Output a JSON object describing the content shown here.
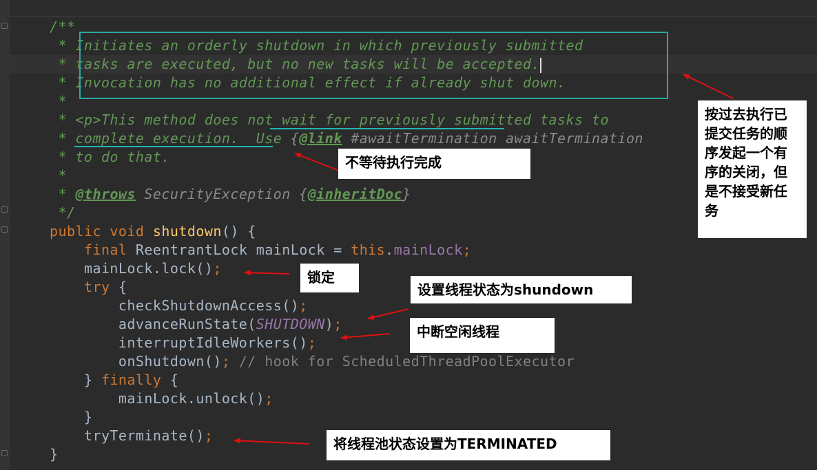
{
  "code_lines": [
    {
      "parts": [
        {
          "t": "/**",
          "c": "c"
        }
      ]
    },
    {
      "parts": [
        {
          "t": " * ",
          "c": "c"
        },
        {
          "t": "Initiates an orderly shutdown in which previously submitted",
          "c": "c"
        }
      ]
    },
    {
      "parts": [
        {
          "t": " * ",
          "c": "c"
        },
        {
          "t": "tasks are executed, but no new tasks will be accepted.",
          "c": "c"
        }
      ]
    },
    {
      "parts": [
        {
          "t": " * ",
          "c": "c"
        },
        {
          "t": "Invocation has no additional effect if already shut down.",
          "c": "c"
        }
      ]
    },
    {
      "parts": [
        {
          "t": " *",
          "c": "c"
        }
      ]
    },
    {
      "parts": [
        {
          "t": " * ",
          "c": "c"
        },
        {
          "t": "<p>",
          "c": "tag"
        },
        {
          "t": "This method does not wait for previously submitted tasks to",
          "c": "c"
        }
      ]
    },
    {
      "parts": [
        {
          "t": " * ",
          "c": "c"
        },
        {
          "t": "complete execution.  Use ",
          "c": "c"
        },
        {
          "t": "{",
          "c": "ref"
        },
        {
          "t": "@link",
          "c": "tagb"
        },
        {
          "t": " #awaitTermination awaitTermination",
          "c": "ref"
        }
      ]
    },
    {
      "parts": [
        {
          "t": " * ",
          "c": "c"
        },
        {
          "t": "to do that.",
          "c": "c"
        }
      ]
    },
    {
      "parts": [
        {
          "t": " *",
          "c": "c"
        }
      ]
    },
    {
      "parts": [
        {
          "t": " * ",
          "c": "c"
        },
        {
          "t": "@throws",
          "c": "tagb"
        },
        {
          "t": " SecurityException ",
          "c": "ref"
        },
        {
          "t": "{",
          "c": "ref"
        },
        {
          "t": "@inheritDoc",
          "c": "tagb"
        },
        {
          "t": "}",
          "c": "ref"
        }
      ]
    },
    {
      "parts": [
        {
          "t": " */",
          "c": "c"
        }
      ]
    },
    {
      "parts": [
        {
          "t": "public void ",
          "c": "k"
        },
        {
          "t": "shutdown",
          "c": "fn"
        },
        {
          "t": "() {",
          "c": ""
        }
      ]
    },
    {
      "parts": [
        {
          "t": "    final ",
          "c": "k"
        },
        {
          "t": "ReentrantLock mainLock = ",
          "c": ""
        },
        {
          "t": "this",
          "c": "k"
        },
        {
          "t": ".",
          "c": ""
        },
        {
          "t": "mainLock",
          "c": "f"
        },
        {
          "t": ";",
          "c": "k"
        }
      ]
    },
    {
      "parts": [
        {
          "t": "    mainLock.lock()",
          "c": ""
        },
        {
          "t": ";",
          "c": "k"
        }
      ]
    },
    {
      "parts": [
        {
          "t": "    try ",
          "c": "k"
        },
        {
          "t": "{",
          "c": ""
        }
      ]
    },
    {
      "parts": [
        {
          "t": "        checkShutdownAccess()",
          "c": ""
        },
        {
          "t": ";",
          "c": "k"
        }
      ]
    },
    {
      "parts": [
        {
          "t": "        advanceRunState(",
          "c": ""
        },
        {
          "t": "SHUTDOWN",
          "c": "fi"
        },
        {
          "t": ")",
          "c": ""
        },
        {
          "t": ";",
          "c": "k"
        }
      ]
    },
    {
      "parts": [
        {
          "t": "        interruptIdleWorkers()",
          "c": ""
        },
        {
          "t": ";",
          "c": "k"
        }
      ]
    },
    {
      "parts": [
        {
          "t": "        onShutdown()",
          "c": ""
        },
        {
          "t": "; ",
          "c": "k"
        },
        {
          "t": "// hook for ScheduledThreadPoolExecutor",
          "c": "gc"
        }
      ]
    },
    {
      "parts": [
        {
          "t": "    } ",
          "c": ""
        },
        {
          "t": "finally ",
          "c": "k"
        },
        {
          "t": "{",
          "c": ""
        }
      ]
    },
    {
      "parts": [
        {
          "t": "        mainLock.unlock()",
          "c": ""
        },
        {
          "t": ";",
          "c": "k"
        }
      ]
    },
    {
      "parts": [
        {
          "t": "    }",
          "c": ""
        }
      ]
    },
    {
      "parts": [
        {
          "t": "    tryTerminate()",
          "c": ""
        },
        {
          "t": ";",
          "c": "k"
        }
      ]
    },
    {
      "parts": [
        {
          "t": "}",
          "c": ""
        }
      ]
    }
  ],
  "annotations": {
    "orderly_shutdown": "按过去执行已提交任务的顺序发起一个有序的关闭，但是不接受新任务",
    "no_wait": "不等待执行完成",
    "lock": "锁定",
    "set_state": "设置线程状态为shundown",
    "interrupt_idle": "中断空闲线程",
    "terminate": "将线程池状态设置为TERMINATED"
  },
  "colors": {
    "background": "#2b2b2b",
    "comment": "#629755",
    "keyword": "#cc7832",
    "method": "#ffc66d",
    "field": "#9876aa",
    "highlight_box": "#2aa9a3",
    "arrow": "#e01010"
  }
}
